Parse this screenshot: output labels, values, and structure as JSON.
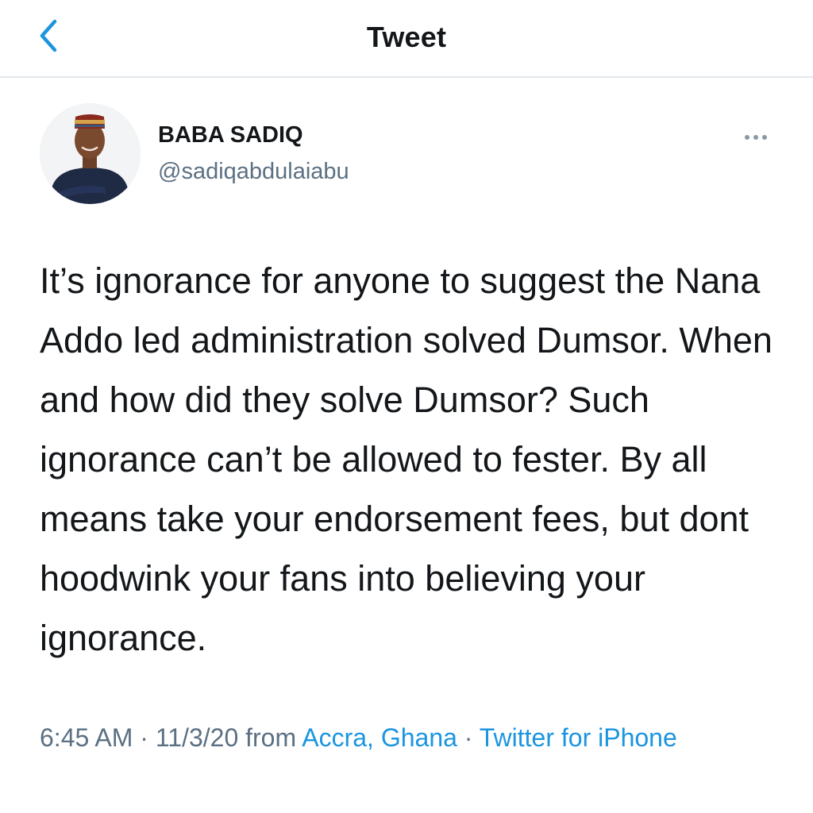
{
  "header": {
    "title": "Tweet",
    "back_icon": "chevron-left-icon",
    "accent_color": "#1b95e0"
  },
  "author": {
    "name": "BABA SADIQ",
    "handle": "@sadiqabdulaiabu",
    "more_icon": "more-horizontal-icon"
  },
  "tweet": {
    "text": "It’s ignorance for anyone to suggest the Nana Addo led administration solved Dumsor. When and how did they solve Dumsor? Such ignorance can’t be allowed to fester. By all means take your endorsement fees, but dont hoodwink your fans into believing your ignorance."
  },
  "meta": {
    "time": "6:45 AM",
    "separator": "·",
    "date": "11/3/20",
    "from_label": "from",
    "location": "Accra, Ghana",
    "client": "Twitter for iPhone"
  },
  "colors": {
    "text": "#14171a",
    "secondary": "#5b7083",
    "link": "#1b95e0",
    "divider": "#e1e8ed"
  }
}
